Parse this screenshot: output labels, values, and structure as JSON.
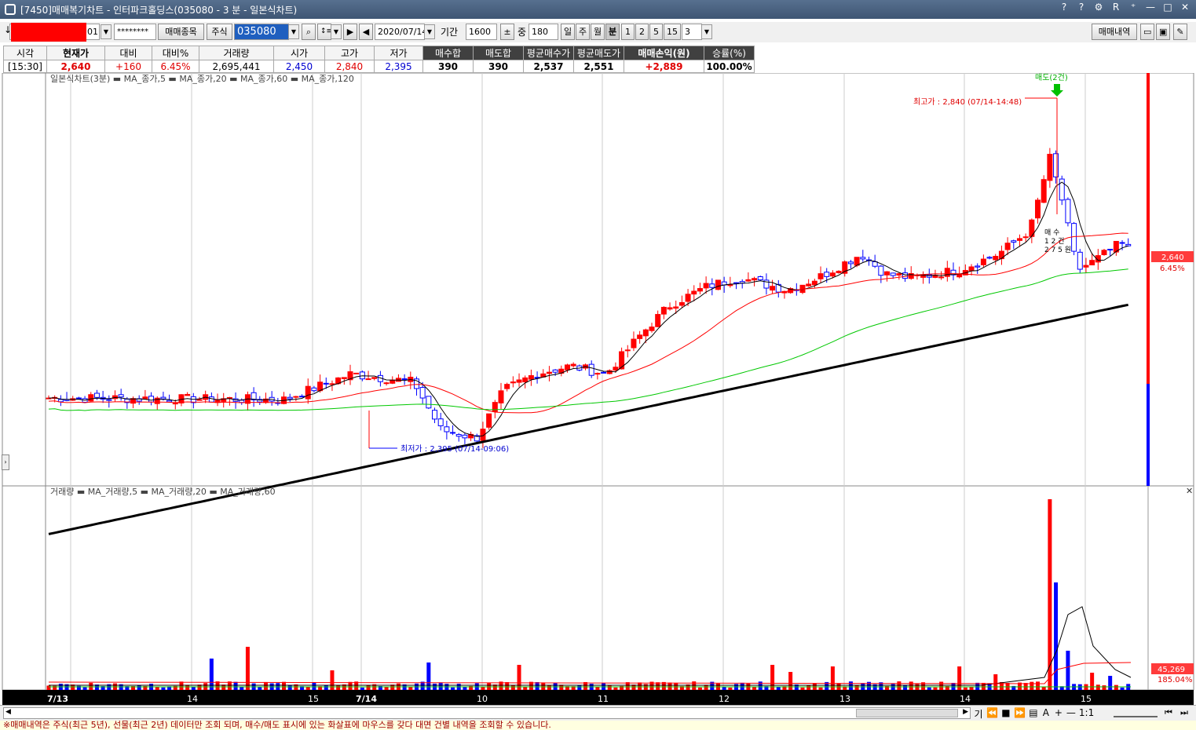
{
  "window": {
    "title": "[7450]매매복기차트 - 인터파크홀딩스(035080 - 3 분 - 일본식차트)",
    "controls": [
      "?",
      "?",
      "⚙",
      "R",
      "⁺",
      "—",
      "□",
      "✕"
    ]
  },
  "toolbar": {
    "account_suffix": "01",
    "password": "********",
    "trade_items_label": "매매종목",
    "market_label": "주식",
    "code": "035080",
    "date": "2020/07/14",
    "period_label": "기간",
    "period_value": "1600",
    "count_label": "중",
    "count_value": "180",
    "interval_day": "일",
    "interval_week": "주",
    "interval_month": "월",
    "interval_minute": "분",
    "minutes": [
      "1",
      "2",
      "5",
      "15"
    ],
    "minute_value": "3",
    "history_button": "매매내역"
  },
  "price_table": {
    "headers": [
      "시각",
      "현재가",
      "대비",
      "대비%",
      "거래량",
      "시가",
      "고가",
      "저가",
      "매수합",
      "매도합",
      "평균매수가",
      "평균매도가",
      "매매손익(원)",
      "승률(%)"
    ],
    "values": [
      "[15:30]",
      "2,640",
      "+160",
      "6.45%",
      "2,695,441",
      "2,450",
      "2,840",
      "2,395",
      "390",
      "390",
      "2,537",
      "2,551",
      "+2,889",
      "100.00%"
    ]
  },
  "colors": {
    "up": "#ff0000",
    "down": "#0000ff",
    "ma5": "#000000",
    "ma20": "#ff0000",
    "ma60": "#00c800",
    "ma120": "#000000",
    "price_badge": "#ff3b3b"
  },
  "price_panel": {
    "legend_title": "일본식차트(3분)",
    "legend_items": [
      {
        "name": "MA_종가,5",
        "color": "#ff0000"
      },
      {
        "name": "MA_종가,20",
        "color": "#000000"
      },
      {
        "name": "MA_종가,60",
        "color": "#ff0000"
      },
      {
        "name": "MA_종가,120",
        "color": "#00c800"
      }
    ],
    "high_annotation": "최고가 : 2,840 (07/14-14:48)",
    "low_annotation": "최저가 : 2,395 (07/14-09:06)",
    "sell_marker": "매도(2건)",
    "trade_label_lines": [
      "매 수",
      "1 2 건",
      "2 7 5 원"
    ],
    "current_price": "2,640",
    "current_pct": "6.45%"
  },
  "volume_panel": {
    "legend_title": "거래량",
    "legend_items": [
      {
        "name": "MA_거래량,5",
        "color": "#ff0000"
      },
      {
        "name": "MA_거래량,20",
        "color": "#000000"
      },
      {
        "name": "MA_거래량,60",
        "color": "#ff0000"
      }
    ],
    "current_volume": "45,269",
    "current_pct": "185.04%"
  },
  "time_axis": {
    "labels": [
      {
        "text": "7/13",
        "bold": true
      },
      {
        "text": "14",
        "bold": false
      },
      {
        "text": "15",
        "bold": false
      },
      {
        "text": "7/14",
        "bold": true
      },
      {
        "text": "10",
        "bold": false
      },
      {
        "text": "11",
        "bold": false
      },
      {
        "text": "12",
        "bold": false
      },
      {
        "text": "13",
        "bold": false
      },
      {
        "text": "14",
        "bold": false
      },
      {
        "text": "15",
        "bold": false
      }
    ]
  },
  "bottom_controls": [
    "기",
    "⏪",
    "■",
    "⏩",
    "▤",
    "A",
    "+",
    "—",
    "1:1"
  ],
  "notice": "※매매내역은 주식(최근 5년), 선물(최근 2년) 데이터만 조회 되며, 매수/매도 표시에 있는 화살표에 마우스를 갖다 대면 건별 내역을 조회할 수 있습니다."
}
